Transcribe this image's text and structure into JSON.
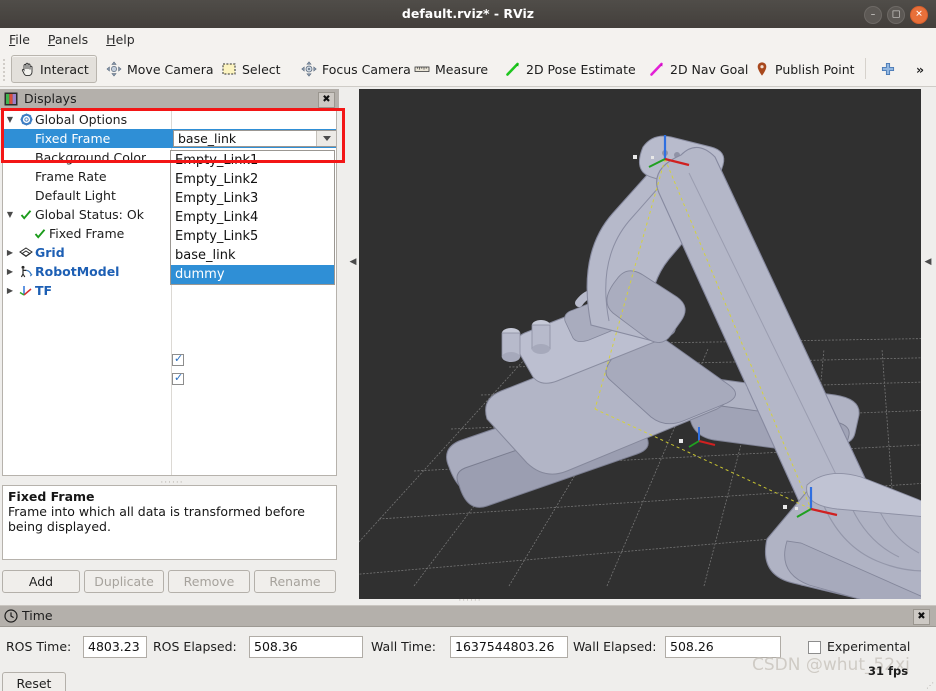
{
  "window": {
    "title": "default.rviz* - RViz",
    "buttons": {
      "minimize": "–",
      "maximize": "□",
      "close": "✕"
    }
  },
  "menubar": {
    "items": [
      "File",
      "Panels",
      "Help"
    ]
  },
  "toolbar": {
    "buttons": [
      {
        "label": "Interact",
        "icon": "hand-cursor-icon",
        "active": true
      },
      {
        "label": "Move Camera",
        "icon": "move-camera-icon",
        "active": false
      },
      {
        "label": "Select",
        "icon": "select-rect-icon",
        "active": false
      },
      {
        "label": "Focus Camera",
        "icon": "focus-camera-icon",
        "active": false
      },
      {
        "label": "Measure",
        "icon": "ruler-icon",
        "active": false
      },
      {
        "label": "2D Pose Estimate",
        "icon": "green-arrow-icon",
        "active": false
      },
      {
        "label": "2D Nav Goal",
        "icon": "magenta-arrow-icon",
        "active": false
      },
      {
        "label": "Publish Point",
        "icon": "map-pin-icon",
        "active": false
      }
    ],
    "add_tool_icon": "plus-icon",
    "overflow_label": "»"
  },
  "displays_panel": {
    "title": "Displays",
    "close_label": "✖",
    "tree": [
      {
        "name": "Global Options",
        "icon": "gear-icon",
        "expander": "▼",
        "indent": 0,
        "style": "normal",
        "value_type": "none"
      },
      {
        "name": "Fixed Frame",
        "icon": "",
        "expander": "",
        "indent": 1,
        "style": "selected",
        "value_type": "combo"
      },
      {
        "name": "Background Color",
        "icon": "",
        "expander": "",
        "indent": 1,
        "style": "normal",
        "value_type": "hidden"
      },
      {
        "name": "Frame Rate",
        "icon": "",
        "expander": "",
        "indent": 1,
        "style": "normal",
        "value_type": "hidden"
      },
      {
        "name": "Default Light",
        "icon": "",
        "expander": "",
        "indent": 1,
        "style": "normal",
        "value_type": "hidden"
      },
      {
        "name": "Global Status: Ok",
        "icon": "check-icon",
        "expander": "▼",
        "indent": 0,
        "style": "normal",
        "value_type": "hidden"
      },
      {
        "name": "Fixed Frame",
        "icon": "check-icon",
        "expander": "",
        "indent": 1,
        "style": "normal",
        "value_type": "hidden"
      },
      {
        "name": "Grid",
        "icon": "grid-icon",
        "expander": "▶",
        "indent": 0,
        "style": "link",
        "value_type": "hidden"
      },
      {
        "name": "RobotModel",
        "icon": "robot-icon",
        "expander": "▶",
        "indent": 0,
        "style": "link",
        "value_type": "checkbox"
      },
      {
        "name": "TF",
        "icon": "axes-icon",
        "expander": "▶",
        "indent": 0,
        "style": "link",
        "value_type": "checkbox"
      }
    ],
    "fixed_frame_value": "base_link",
    "dropdown": {
      "options": [
        "Empty_Link1",
        "Empty_Link2",
        "Empty_Link3",
        "Empty_Link4",
        "Empty_Link5",
        "base_link",
        "dummy"
      ],
      "highlighted": "dummy"
    },
    "description": {
      "title": "Fixed Frame",
      "body": "Frame into which all data is transformed before being displayed."
    },
    "buttons": [
      {
        "label": "Add",
        "enabled": true
      },
      {
        "label": "Duplicate",
        "enabled": false
      },
      {
        "label": "Remove",
        "enabled": false
      },
      {
        "label": "Rename",
        "enabled": false
      }
    ]
  },
  "view3d": {
    "background_color": "#303030",
    "grid_color": "#8e8e8e",
    "robot_color": "#a8abbd",
    "collapse_left": "◀",
    "collapse_right": "◀"
  },
  "time_panel": {
    "title": "Time",
    "close_label": "✖",
    "fields": [
      {
        "label": "ROS Time:",
        "value": "4803.23"
      },
      {
        "label": "ROS Elapsed:",
        "value": "508.36"
      },
      {
        "label": "Wall Time:",
        "value": "1637544803.26"
      },
      {
        "label": "Wall Elapsed:",
        "value": "508.26"
      }
    ],
    "experimental_label": "Experimental",
    "experimental_checked": false,
    "reset_label": "Reset"
  },
  "overlay": {
    "watermark": "CSDN @whut_52xj",
    "fps": "31 fps"
  }
}
